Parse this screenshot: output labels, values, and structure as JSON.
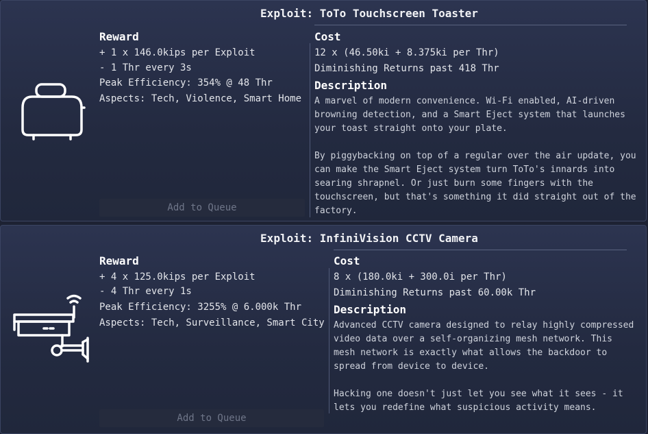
{
  "exploits": [
    {
      "title": "Exploit: ToTo Touchscreen Toaster",
      "icon": "toaster-icon",
      "reward_heading": "Reward",
      "reward_lines": [
        "+ 1 x 146.0kips per Exploit",
        "- 1 Thr every 3s",
        "Peak Efficiency: 354% @ 48 Thr",
        "Aspects: Tech, Violence, Smart Home"
      ],
      "cost_heading": "Cost",
      "cost_lines": [
        "12 x (46.50ki + 8.375ki per Thr)",
        "Diminishing Returns past 418 Thr"
      ],
      "description_heading": "Description",
      "description": "A marvel of modern convenience. Wi-Fi enabled, AI-driven\nbrowning detection, and a Smart Eject system that launches\nyour toast straight onto your plate.\n\nBy piggybacking on top of a regular over the air update, you\ncan make the Smart Eject system turn ToTo's innards into\nsearing shrapnel. Or just burn some fingers with the\ntouchscreen, but that's something it did straight out of the\nfactory.",
      "button_label": "Add to Queue"
    },
    {
      "title": "Exploit: InfiniVision CCTV Camera",
      "icon": "cctv-camera-icon",
      "reward_heading": "Reward",
      "reward_lines": [
        "+ 4 x 125.0kips per Exploit",
        "- 4 Thr every 1s",
        "Peak Efficiency: 3255% @ 6.000k Thr",
        "Aspects: Tech, Surveillance, Smart City"
      ],
      "cost_heading": "Cost",
      "cost_lines": [
        "8 x (180.0ki + 300.0i per Thr)",
        "Diminishing Returns past 60.00k Thr"
      ],
      "description_heading": "Description",
      "description": "Advanced CCTV camera designed to relay highly compressed\nvideo data over a self-organizing mesh network. This\nmesh network is exactly what allows the backdoor to\nspread from device to device.\n\nHacking one doesn't just let you see what it sees - it\nlets you redefine what suspicious activity means.",
      "button_label": "Add to Queue"
    }
  ]
}
